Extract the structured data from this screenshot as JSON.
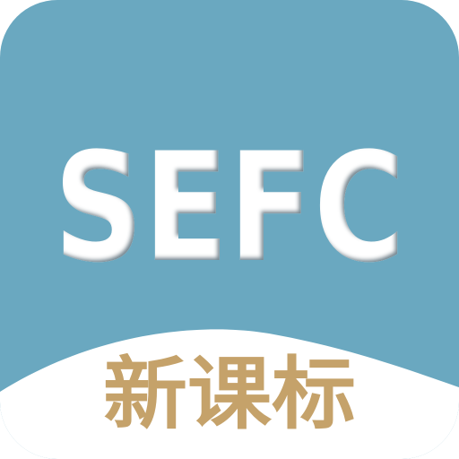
{
  "icon": {
    "logo_text": "SEFC",
    "caption": "新课标"
  },
  "colors": {
    "background_blue": "#6aa8c0",
    "bottom_white": "#ffffff",
    "logo_fill": "#ffffff",
    "logo_shadow": "#2e5f72",
    "caption_gold": "#c5a26a"
  }
}
